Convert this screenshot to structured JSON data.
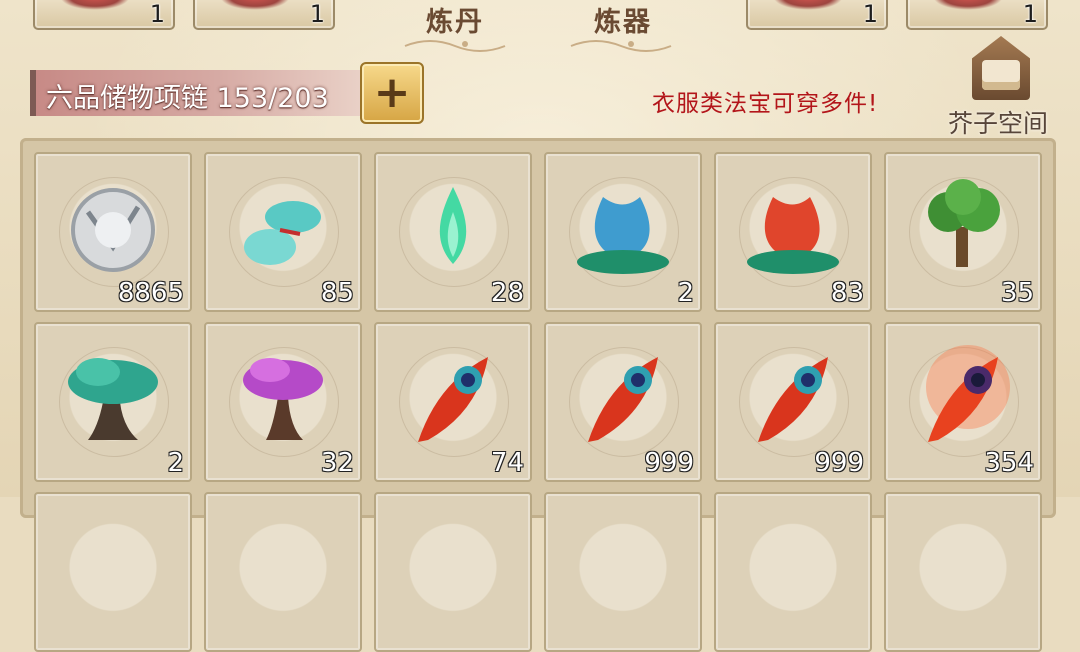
{
  "top_slots": [
    {
      "count": "1",
      "icon": "equip-bow-icon"
    },
    {
      "count": "1",
      "icon": "equip-sword-icon"
    },
    {
      "count": "1",
      "icon": "equip-charm-icon"
    },
    {
      "count": "1",
      "icon": "equip-talisman-icon"
    }
  ],
  "tabs": {
    "alchemy": "炼丹",
    "forging": "炼器"
  },
  "storage": {
    "name": "六品储物项链 153/203",
    "add_icon": "plus-icon"
  },
  "notice": "衣服类法宝可穿多件!",
  "space_button": {
    "label": "芥子空间",
    "icon": "chest-icon"
  },
  "colors": {
    "notice": "#b3151a",
    "plus_button": "#e6bd5f"
  },
  "items": [
    {
      "name": "silver-disc-icon",
      "count": "8865"
    },
    {
      "name": "jade-gourd-icon",
      "count": "85"
    },
    {
      "name": "green-flame-icon",
      "count": "28"
    },
    {
      "name": "blue-water-drop-icon",
      "count": "2"
    },
    {
      "name": "red-water-drop-icon",
      "count": "83"
    },
    {
      "name": "green-tree-icon",
      "count": "35"
    },
    {
      "name": "teal-tree-icon",
      "count": "2"
    },
    {
      "name": "purple-tree-icon",
      "count": "32"
    },
    {
      "name": "phoenix-feather-icon",
      "count": "74"
    },
    {
      "name": "phoenix-feather-icon",
      "count": "999"
    },
    {
      "name": "phoenix-feather-icon",
      "count": "999"
    },
    {
      "name": "glowing-phoenix-feather-icon",
      "count": "354"
    }
  ]
}
